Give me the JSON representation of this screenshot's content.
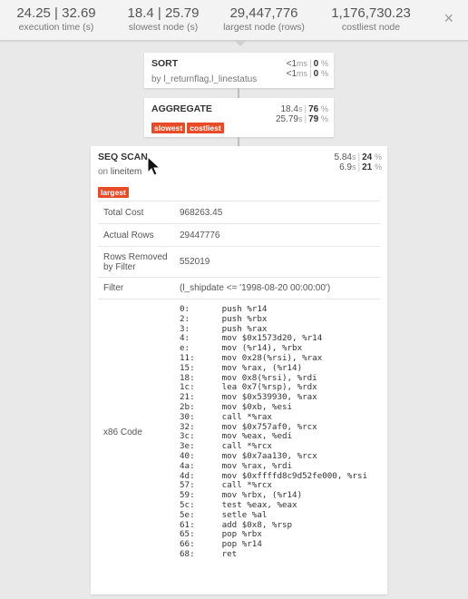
{
  "header": {
    "stats": [
      {
        "value": "24.25 | 32.69",
        "label": "execution time (s)"
      },
      {
        "value": "18.4 | 25.79",
        "label": "slowest node (s)"
      },
      {
        "value": "29,447,776",
        "label": "largest node (rows)"
      },
      {
        "value": "1,176,730.23",
        "label": "costliest node"
      }
    ],
    "close_icon": "×"
  },
  "nodes": {
    "sort": {
      "title": "SORT",
      "subtitle": "by l_returnflag,l_linestatus",
      "time1": "<1",
      "unit1": "ms",
      "pct1": "0",
      "pct_sign1": "%",
      "time2": "<1",
      "unit2": "ms",
      "pct2": "0",
      "pct_sign2": "%"
    },
    "aggregate": {
      "title": "AGGREGATE",
      "tags": [
        "slowest",
        "costliest"
      ],
      "time1": "18.4",
      "unit1": "s",
      "pct1": "76",
      "pct_sign1": "%",
      "time2": "25.79",
      "unit2": "s",
      "pct2": "79",
      "pct_sign2": "%"
    },
    "seqscan": {
      "title": "SEQ SCAN",
      "on_label": "on",
      "relation": "lineitem",
      "tags": [
        "largest"
      ],
      "time1": "5.84",
      "unit1": "s",
      "pct1": "24",
      "pct_sign1": "%",
      "time2": "6.9",
      "unit2": "s",
      "pct2": "21",
      "pct_sign2": "%",
      "details": {
        "total_cost_label": "Total Cost",
        "total_cost": "968263.45",
        "actual_rows_label": "Actual Rows",
        "actual_rows": "29447776",
        "rows_removed_label": "Rows Removed by Filter",
        "rows_removed": "552019",
        "filter_label": "Filter",
        "filter": "(l_shipdate <= '1998-08-20 00:00:00')",
        "code_label": "x86 Code",
        "code": [
          [
            "0:",
            "push %r14"
          ],
          [
            "2:",
            "push %rbx"
          ],
          [
            "3:",
            "push %rax"
          ],
          [
            "4:",
            "mov $0x1573d20, %r14"
          ],
          [
            "e:",
            "mov (%r14), %rbx"
          ],
          [
            "11:",
            "mov 0x28(%rsi), %rax"
          ],
          [
            "15:",
            "mov %rax, (%r14)"
          ],
          [
            "18:",
            "mov 0x8(%rsi), %rdi"
          ],
          [
            "1c:",
            "lea 0x7(%rsp), %rdx"
          ],
          [
            "21:",
            "mov $0x539930, %rax"
          ],
          [
            "2b:",
            "mov $0xb, %esi"
          ],
          [
            "30:",
            "call *%rax"
          ],
          [
            "32:",
            "mov $0x757af0, %rcx"
          ],
          [
            "3c:",
            "mov %eax, %edi"
          ],
          [
            "3e:",
            "call *%rcx"
          ],
          [
            "40:",
            "mov $0x7aa130, %rcx"
          ],
          [
            "4a:",
            "mov %rax, %rdi"
          ],
          [
            "4d:",
            "mov $0xffffd8c9d52fe000, %rsi"
          ],
          [
            "57:",
            "call *%rcx"
          ],
          [
            "59:",
            "mov %rbx, (%r14)"
          ],
          [
            "5c:",
            "test %eax, %eax"
          ],
          [
            "5e:",
            "setle %al"
          ],
          [
            "61:",
            "add $0x8, %rsp"
          ],
          [
            "65:",
            "pop %rbx"
          ],
          [
            "66:",
            "pop %r14"
          ],
          [
            "68:",
            "ret"
          ]
        ]
      }
    }
  }
}
